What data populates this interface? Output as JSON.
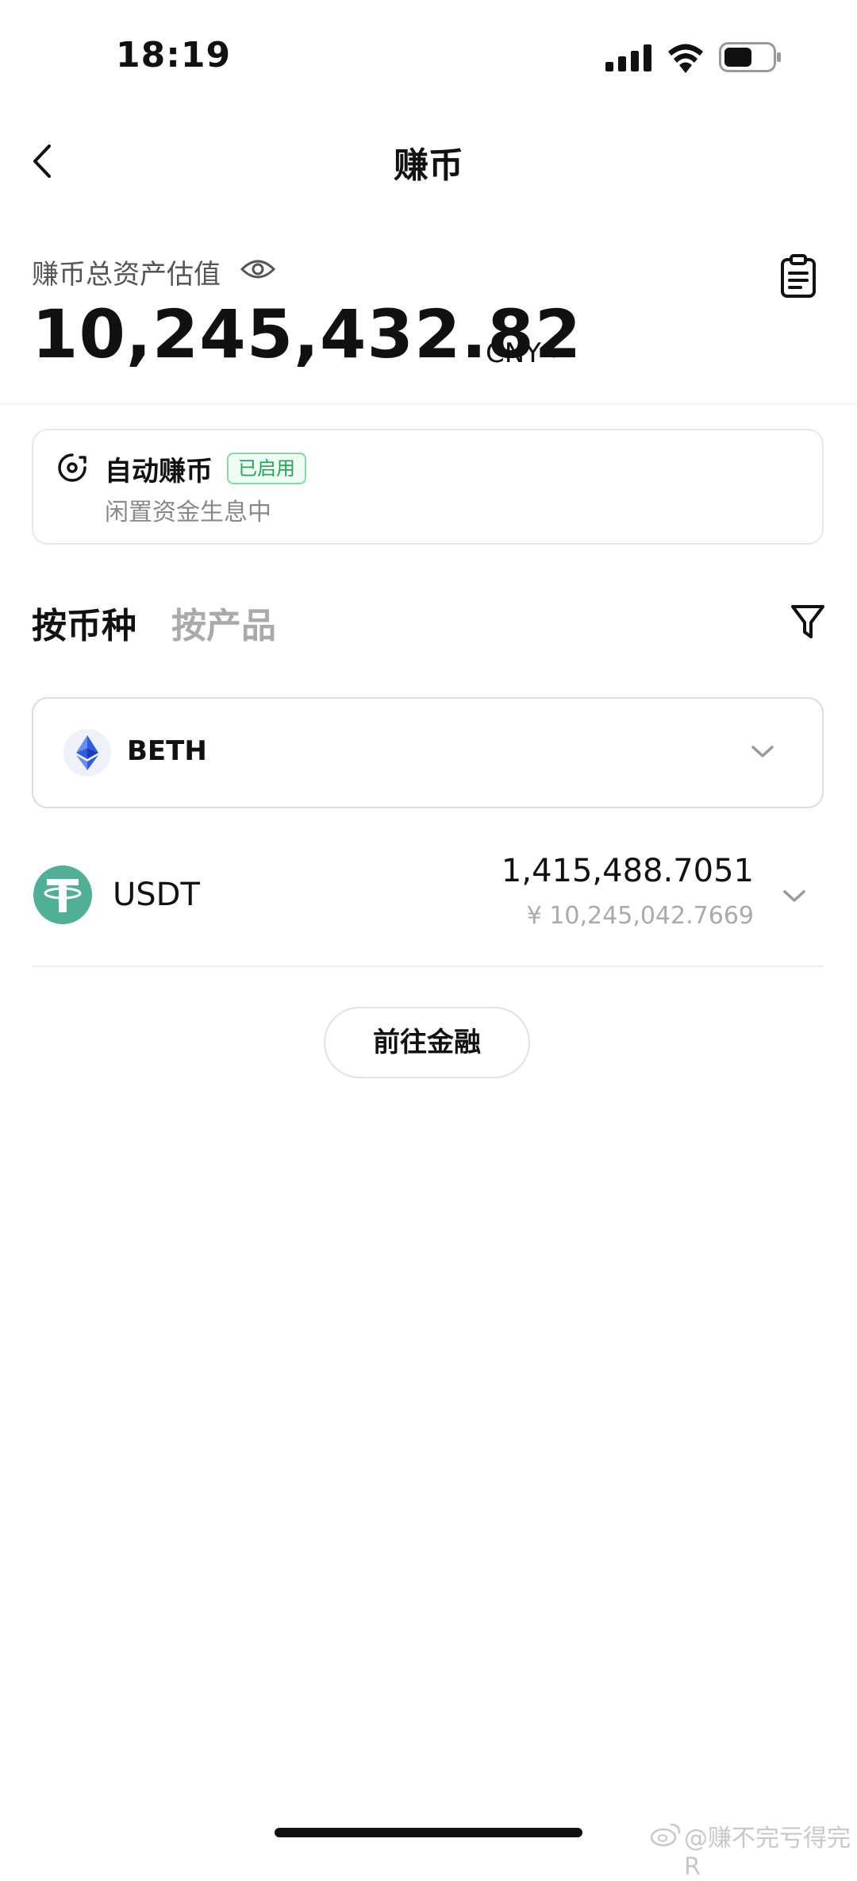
{
  "status_bar": {
    "time": "18:19",
    "signal_icon": "signal-icon",
    "wifi_icon": "wifi-icon",
    "battery_icon": "battery-icon"
  },
  "nav": {
    "title": "赚币",
    "back_icon": "back-chevron-icon"
  },
  "assets": {
    "label": "赚币总资产估值",
    "total": "10,245,432.82",
    "currency": "CNY",
    "eye_icon": "eye-icon",
    "records_icon": "clipboard-icon"
  },
  "auto_earn": {
    "title": "自动赚币",
    "badge": "已启用",
    "subtitle": "闲置资金生息中",
    "badge_color": "#23a55a"
  },
  "tabs": {
    "by_coin": "按币种",
    "by_product": "按产品",
    "filter_icon": "filter-icon"
  },
  "coin_selector": {
    "selected": "BETH",
    "icon": "ethereum-icon"
  },
  "holdings": [
    {
      "symbol": "USDT",
      "amount": "1,415,488.7051",
      "cny_value": "¥ 10,245,042.7669",
      "icon": "tether-icon",
      "color": "#50af95"
    }
  ],
  "goto_button": "前往金融",
  "watermark": "@赚不完亏得完R"
}
